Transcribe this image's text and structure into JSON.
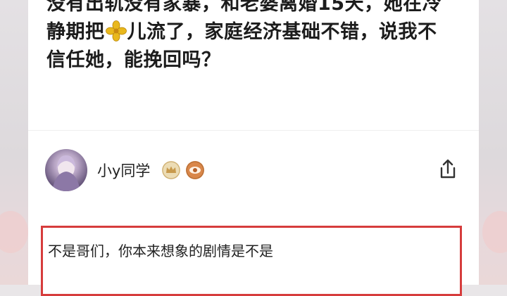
{
  "post": {
    "line1": "没有出轨没有家暴，和老婆离婚15天，她在冷",
    "line2_before": "静期把",
    "line2_after": "儿流了，家庭经济基础不错，说我不",
    "line3": "信任她，能挽回吗？",
    "inline_icon": "flower-icon"
  },
  "answer": {
    "author_name": "小y同学",
    "badges": [
      "rank-badge-icon",
      "eye-badge-icon"
    ],
    "share_icon": "share-icon",
    "reply_text": "不是哥们，你本来想象的剧情是不是"
  },
  "colors": {
    "highlight_border": "#d63c3c",
    "flower": "#e9b81c"
  }
}
